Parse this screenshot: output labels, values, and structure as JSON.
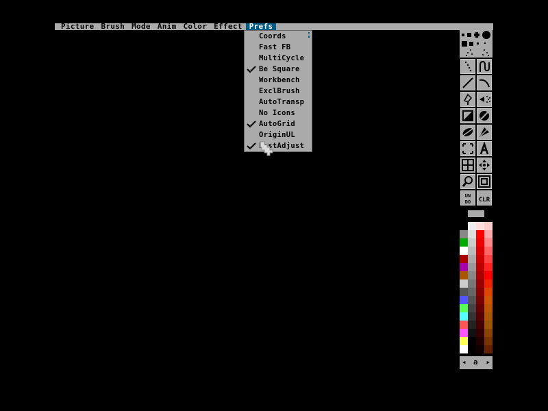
{
  "menubar": {
    "items": [
      {
        "label": "Picture",
        "active": false
      },
      {
        "label": "Brush",
        "active": false
      },
      {
        "label": "Mode",
        "active": false
      },
      {
        "label": "Anim",
        "active": false
      },
      {
        "label": "Color",
        "active": false
      },
      {
        "label": "Effect",
        "active": false
      },
      {
        "label": "Prefs",
        "active": true
      }
    ]
  },
  "prefs_menu": {
    "items": [
      {
        "label": "Coords",
        "checked": false
      },
      {
        "label": "Fast FB",
        "checked": false
      },
      {
        "label": "MultiCycle",
        "checked": false
      },
      {
        "label": "Be Square",
        "checked": true
      },
      {
        "label": "Workbench",
        "checked": false
      },
      {
        "label": "ExclBrush",
        "checked": false
      },
      {
        "label": "AutoTransp",
        "checked": false
      },
      {
        "label": "No Icons",
        "checked": false
      },
      {
        "label": "AutoGrid",
        "checked": true
      },
      {
        "label": "OriginUL",
        "checked": false
      },
      {
        "label": "FastAdjust",
        "checked": true
      }
    ]
  },
  "toolbar": {
    "tools": [
      "dotted-freehand-icon",
      "continuous-freehand-icon",
      "line-icon",
      "curve-icon",
      "fill-icon",
      "airbrush-icon",
      "rectangle-icon",
      "circle-icon",
      "ellipse-icon",
      "polygon-icon",
      "brush-select-icon",
      "text-icon",
      "grid-icon",
      "symmetry-icon",
      "magnify-icon",
      "zoom-icon",
      "undo-icon",
      "clear-icon"
    ],
    "undo_label": "UN DO",
    "clear_label": "CLR"
  },
  "palette": {
    "colors": [
      "#888888",
      "#00aa00",
      "#ffffff",
      "#aa0000",
      "#aa00aa",
      "#aa5500",
      "#cccccc",
      "#555555",
      "#5555ff",
      "#55ff55",
      "#55ffff",
      "#ff5555",
      "#ff55ff",
      "#ffff55",
      "#ffffff"
    ],
    "nav": {
      "left": "◂",
      "letter": "a",
      "right": "▸"
    }
  }
}
